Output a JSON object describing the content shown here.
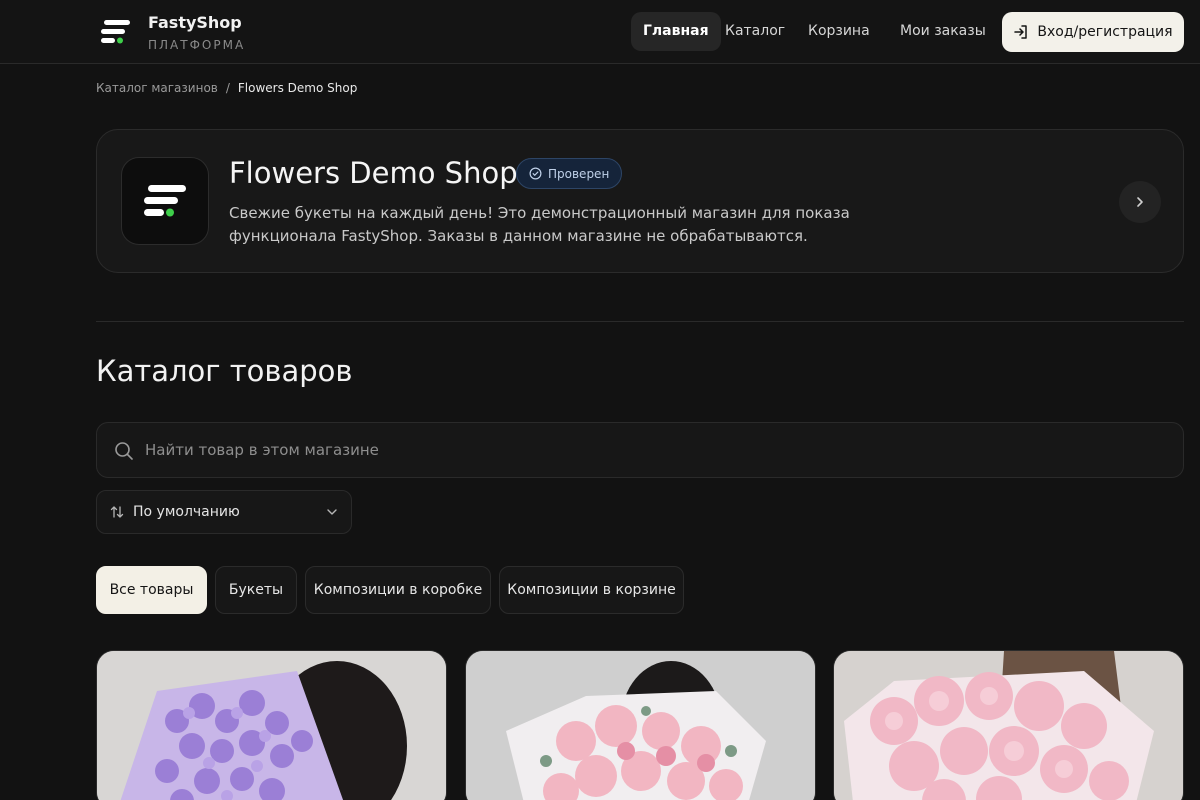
{
  "header": {
    "brand_name": "FastyShop",
    "brand_sub": "ПЛАТФОРМА",
    "nav": [
      {
        "label": "Главная",
        "active": true
      },
      {
        "label": "Каталог",
        "active": false
      },
      {
        "label": "Корзина",
        "active": false
      },
      {
        "label": "Мои заказы",
        "active": false
      }
    ],
    "login_label": "Вход/регистрация",
    "login_icon": "sign-in-icon"
  },
  "breadcrumb": {
    "parent": "Каталог магазинов",
    "separator": "/",
    "current": "Flowers Demo Shop"
  },
  "shop": {
    "title": "Flowers Demo Shop",
    "badge": "Проверен",
    "description": "Свежие букеты на каждый день! Это демонстрационный магазин для показа функционала FastyShop. Заказы в данном магазине не обрабатываются."
  },
  "catalog": {
    "title": "Каталог товаров",
    "search_placeholder": "Найти товар в этом магазине",
    "sort_label": "По умолчанию",
    "categories": [
      {
        "label": "Все товары",
        "active": true
      },
      {
        "label": "Букеты",
        "active": false
      },
      {
        "label": "Композиции в коробке",
        "active": false
      },
      {
        "label": "Композиции в корзине",
        "active": false
      }
    ]
  },
  "colors": {
    "background": "#121212",
    "accent_green": "#3ecf4a",
    "verified_badge_bg": "#15243a",
    "active_chip": "#f3f0e6"
  }
}
